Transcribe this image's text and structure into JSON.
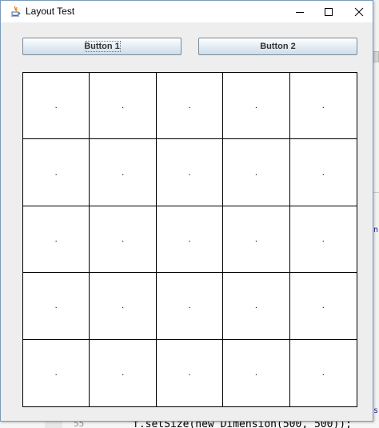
{
  "window": {
    "title": "Layout Test",
    "minimize_glyph": "–",
    "maximize_glyph": "☐",
    "close_glyph": "✕"
  },
  "buttons": [
    "Button 1",
    "Button 2"
  ],
  "grid": {
    "rows": 5,
    "columns": 5,
    "cell_text": "."
  },
  "background_code": {
    "line_number": "55",
    "code": "f.setSize(new Dimension(500, 500));"
  },
  "colors": {
    "window_border": "#7a9ab8",
    "content_background": "#eeeeee",
    "grid_line": "#000000"
  }
}
